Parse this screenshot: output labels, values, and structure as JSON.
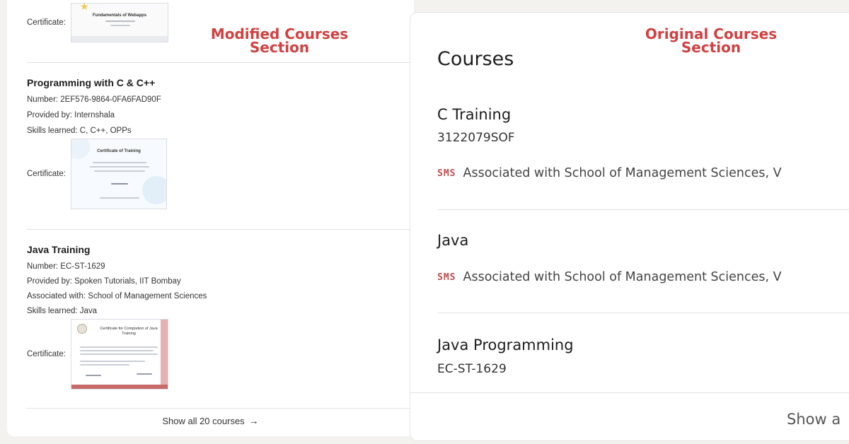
{
  "modified": {
    "section_label_line1": "Modified Courses",
    "section_label_line2": "Section",
    "top_cert": {
      "label": "Certificate:",
      "thumb_title": "Fundamentals of Webapps"
    },
    "courses": [
      {
        "title": "Programming with C & C++",
        "number": "Number: 2EF576-9864-0FA6FAD90F",
        "provider": "Provided by: Internshala",
        "skills": "Skills learned: C, C++, OPPs",
        "cert_label": "Certificate:",
        "thumb_title": "Certificate of Training"
      },
      {
        "title": "Java Training",
        "number": "Number: EC-ST-1629",
        "provider": "Provided by: Spoken Tutorials, IIT Bombay",
        "associated": "Associated with: School of Management Sciences",
        "skills": "Skills learned: Java",
        "cert_label": "Certificate:",
        "thumb_title": "Certificate for Completion of Java Training"
      }
    ],
    "show_all": "Show all 20 courses",
    "show_all_arrow": "→"
  },
  "original": {
    "section_label_line1": "Original Courses",
    "section_label_line2": "Section",
    "heading": "Courses",
    "courses": [
      {
        "title": "C Training",
        "code": "3122079SOF",
        "assoc_logo": "SMS",
        "assoc": "Associated with School of Management Sciences, V"
      },
      {
        "title": "Java",
        "assoc_logo": "SMS",
        "assoc": "Associated with School of Management Sciences, V"
      },
      {
        "title": "Java Programming",
        "code": "EC-ST-1629"
      }
    ],
    "show_all": "Show a"
  },
  "colors": {
    "label_red": "#d14141",
    "background": "#f3f2ef",
    "card": "#ffffff"
  }
}
